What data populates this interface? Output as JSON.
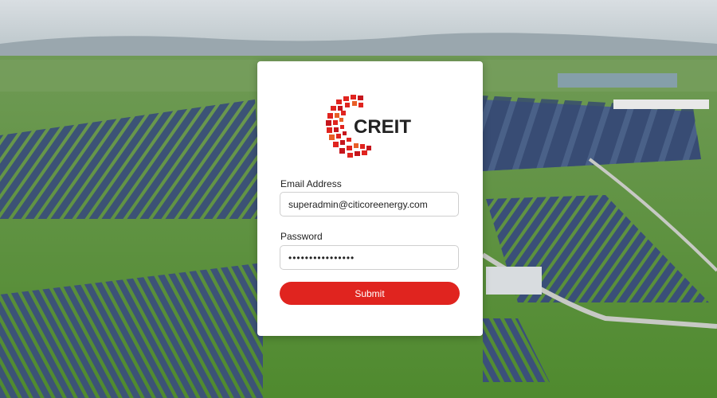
{
  "brand": {
    "name": "CREIT",
    "logo_icon": "creit-logo-icon",
    "accent_color": "#e0241f"
  },
  "form": {
    "email_label": "Email Address",
    "email_value": "superadmin@citicoreenergy.com",
    "password_label": "Password",
    "password_value": "••••••••••••••••",
    "submit_label": "Submit"
  }
}
